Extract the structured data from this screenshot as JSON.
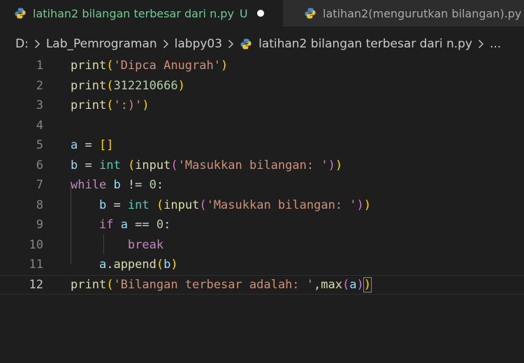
{
  "tabs": [
    {
      "label": "latihan2 bilangan terbesar dari n.py",
      "status": "U"
    },
    {
      "label": "latihan2(mengurutkan bilangan).py"
    }
  ],
  "breadcrumb": {
    "drive": "D:",
    "folder1": "Lab_Pemrograman",
    "folder2": "labpy03",
    "file": "latihan2 bilangan terbesar dari n.py",
    "more": "..."
  },
  "editor": {
    "current_line": 12,
    "lines": [
      {
        "n": "1",
        "text": "print('Dipca Anugrah')"
      },
      {
        "n": "2",
        "text": "print(312210666)"
      },
      {
        "n": "3",
        "text": "print(':)')"
      },
      {
        "n": "4",
        "text": ""
      },
      {
        "n": "5",
        "text": "a = []"
      },
      {
        "n": "6",
        "text": "b = int (input('Masukkan bilangan: '))"
      },
      {
        "n": "7",
        "text": "while b != 0:"
      },
      {
        "n": "8",
        "text": "    b = int (input('Masukkan bilangan: '))"
      },
      {
        "n": "9",
        "text": "    if a == 0:"
      },
      {
        "n": "10",
        "text": "        break"
      },
      {
        "n": "11",
        "text": "    a.append(b)"
      },
      {
        "n": "12",
        "text": "print('Bilangan terbesar adalah: ',max(a))"
      }
    ]
  },
  "colors": {
    "function": "#dcdcaa",
    "string": "#ce9178",
    "number": "#b5cea8",
    "keyword": "#c586c0",
    "builtin": "#4ec9b0",
    "variable": "#9cdcfe"
  },
  "icons": {
    "python": "python-file-icon",
    "chevron": "chevron-right-icon",
    "modified": "unsaved-dot-icon"
  }
}
